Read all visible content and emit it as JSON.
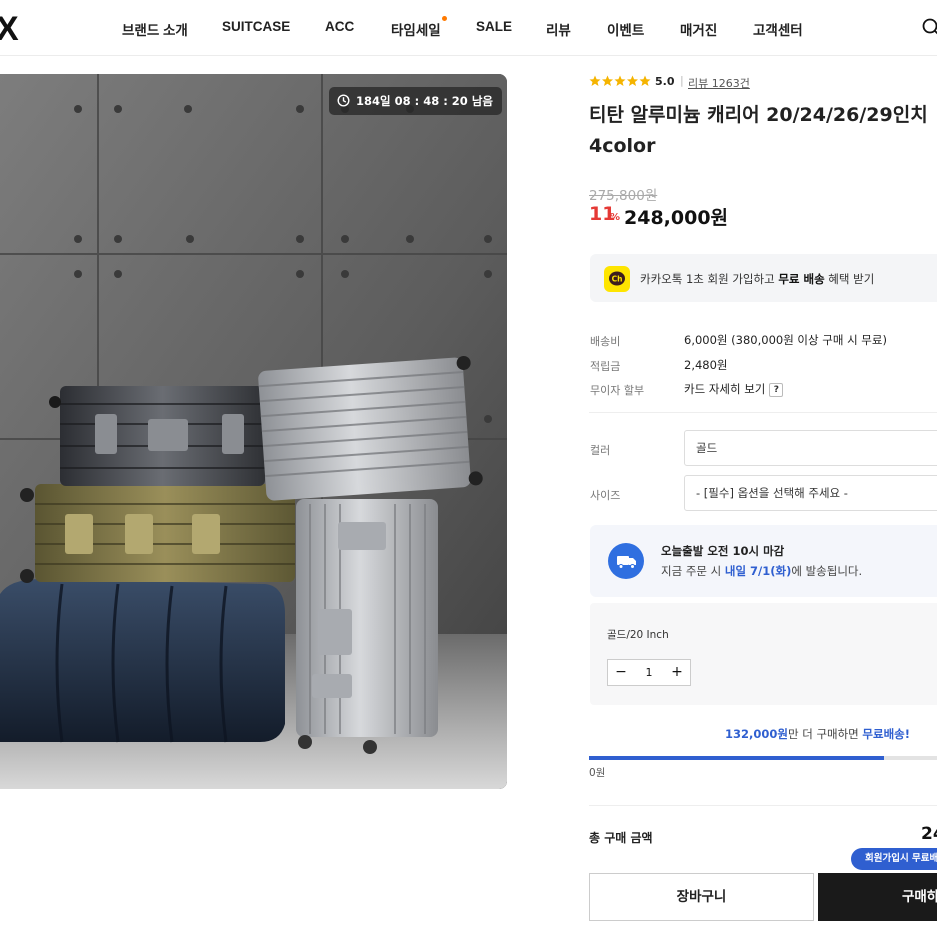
{
  "header": {
    "logo": "X",
    "nav": [
      {
        "label": "브랜드 소개",
        "dot": false
      },
      {
        "label": "SUITCASE",
        "dot": false
      },
      {
        "label": "ACC",
        "dot": false
      },
      {
        "label": "타임세일",
        "dot": true
      },
      {
        "label": "SALE",
        "dot": false
      },
      {
        "label": "리뷰",
        "dot": false
      },
      {
        "label": "이벤트",
        "dot": false
      },
      {
        "label": "매거진",
        "dot": false
      },
      {
        "label": "고객센터",
        "dot": false
      }
    ],
    "nav_dot_color": "#ff7a00",
    "search_icon": "search-icon"
  },
  "product_image": {
    "timer": "184일 08 : 48 : 20 남음",
    "timer_icon": "clock-icon"
  },
  "product": {
    "rating_value": "5.0",
    "rating_stars": 5,
    "review_link": "리뷰 1263건",
    "title": "티탄 알루미늄 캐리어 20/24/26/29인치 4color",
    "price_original": "275,800원",
    "discount": "11",
    "discount_unit": "%",
    "price_sale": "248,000원"
  },
  "kakao_banner": {
    "prefix": "카카오톡 1초 회원 가입하고 ",
    "highlight": "무료 배송",
    "suffix": " 혜택 받기",
    "icon_text": "Ch"
  },
  "specs": [
    {
      "label": "배송비",
      "value": "6,000원 (380,000원 이상 구매 시 무료)"
    },
    {
      "label": "적립금",
      "value": "2,480원"
    },
    {
      "label": "무이자 할부",
      "value": "카드 자세히 보기",
      "badge": "?"
    }
  ],
  "options": {
    "color_label": "컬러",
    "color_value": "골드",
    "size_label": "사이즈",
    "size_value": "- [필수] 옵션을 선택해 주세요 -"
  },
  "shipping": {
    "title": "오늘출발 오전 10시 마감",
    "sub_prefix": "지금 주문 시 ",
    "sub_highlight": "내일 7/1(화)",
    "sub_suffix": "에 발송됩니다."
  },
  "selected_item": {
    "name": "골드/20 Inch",
    "quantity": "1",
    "minus": "−",
    "plus": "+"
  },
  "free_shipping": {
    "amount": "132,000원",
    "middle": "만 더 구매하면 ",
    "free": "무료배송!",
    "progress": 0.82,
    "start_label": "0원"
  },
  "total": {
    "label": "총 구매 금액",
    "value": "24"
  },
  "buttons": {
    "member_badge": "회원가입시 무료배",
    "cart": "장바구니",
    "buy": "구매하"
  },
  "colors": {
    "accent_blue": "#2f5fd0",
    "sale_red": "#e53935",
    "kakao_yellow": "#fee500",
    "star": "#f5b400"
  }
}
